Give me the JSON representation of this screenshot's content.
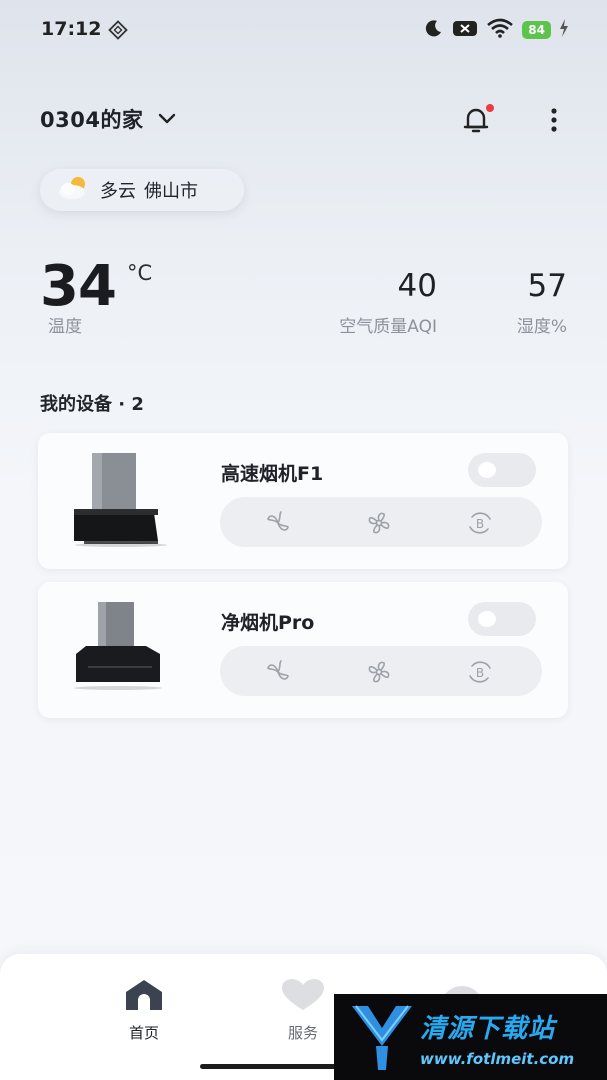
{
  "status_bar": {
    "time": "17:12",
    "battery": "84"
  },
  "header": {
    "home_name": "0304的家"
  },
  "weather": {
    "condition": "多云",
    "city": "佛山市"
  },
  "stats": {
    "temperature": "34",
    "temperature_unit": "°C",
    "temperature_label": "温度",
    "aqi": "40",
    "aqi_label": "空气质量AQI",
    "humidity": "57",
    "humidity_label": "湿度%"
  },
  "devices": {
    "header": "我的设备 · 2",
    "items": [
      {
        "name": "高速烟机F1"
      },
      {
        "name": "净烟机Pro"
      }
    ]
  },
  "bottom_nav": {
    "items": [
      {
        "label": "首页",
        "icon": "home-icon"
      },
      {
        "label": "服务",
        "icon": "heart-icon"
      },
      {
        "label": "",
        "icon": "profile-icon"
      }
    ]
  },
  "watermark": {
    "text": "清源下载站",
    "url": "www.fotlmeit.com"
  }
}
